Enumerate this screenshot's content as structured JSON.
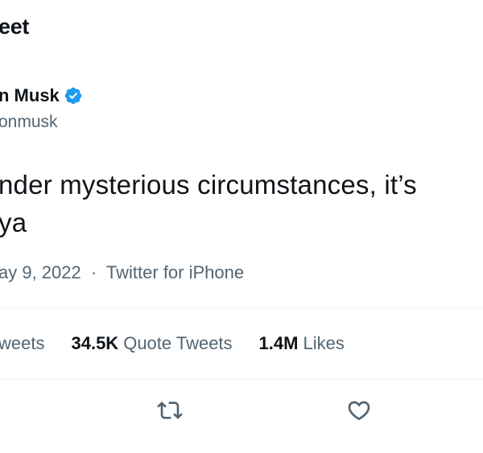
{
  "header": {
    "title": "eet"
  },
  "author": {
    "display_name": "n Musk",
    "handle": "onmusk",
    "verified_icon": "verified-badge-icon",
    "verified_color": "#1d9bf0"
  },
  "tweet": {
    "line1": "nder mysterious circumstances, it’s",
    "line2": "ya"
  },
  "meta": {
    "date": "ay 9, 2022",
    "separator": "·",
    "source": "Twitter for iPhone"
  },
  "stats": {
    "retweets_label": "weets",
    "quote_tweets_value": "34.5K",
    "quote_tweets_label": "Quote Tweets",
    "likes_value": "1.4M",
    "likes_label": "Likes"
  },
  "actions": {
    "retweet_icon": "retweet-icon",
    "like_icon": "heart-icon",
    "icon_color": "#536471"
  }
}
